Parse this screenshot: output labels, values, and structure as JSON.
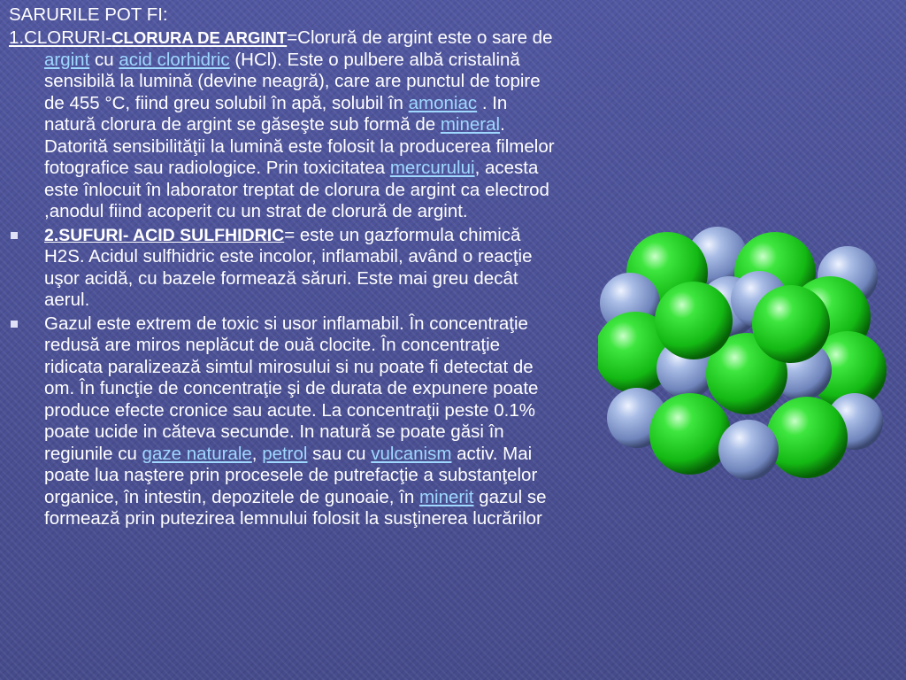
{
  "slide": {
    "title": "SARURILE POT FI:",
    "p1": {
      "prefix": "1.CLORURI-",
      "bold": "CLORURA DE ARGINT",
      "t1": "=Clorură de argint este o sare de ",
      "link1": "argint",
      "t2": " cu ",
      "link2": "acid clorhidric",
      "t3": " (HCl). Este o pulbere albă cristalină sensibilă la lumină (devine neagră), care are punctul de topire de 455 °C, fiind greu solubil în apă, solubil în ",
      "link3": "amoniac",
      "t4": " . In natură clorura de argint se găseşte sub formă de ",
      "link4": "mineral",
      "t5": ". Datorită sensibilităţii la lumină este folosit la producerea filmelor fotografice sau radiologice. Prin toxicitatea ",
      "link5": "mercurului",
      "t6": ", acesta este înlocuit în laborator treptat de clorura de argint ca electrod ,anodul fiind acoperit cu un strat de clorură de argint."
    },
    "b1": {
      "title": "2.SUFURI- ACID SULFHIDRIC",
      "text": "= este un gazformula chimică H2S. Acidul sulfhidric  este incolor, inflamabil, având o reacţie uşor acidă, cu bazele formează săruri. Este mai greu decât aerul."
    },
    "b2": {
      "t1": "Gazul este extrem de toxic si usor inflamabil. În concentraţie redusă are miros neplăcut de ouă clocite. În concentraţie ridicata paralizează simtul mirosului si nu poate fi detectat de om. În funcţie de concentraţie şi de durata de expunere poate produce efecte cronice sau acute. La concentraţii peste 0.1% poate ucide in căteva secunde. In natură se poate găsi în regiunile cu ",
      "link1": "gaze naturale",
      "t2": ", ",
      "link2": "petrol",
      "t3": " sau cu ",
      "link3": "vulcanism",
      "t4": " activ. Mai poate lua naştere prin procesele de putrefacţie a substanţelor organice, în intestin, depozitele de gunoaie, în ",
      "link4": "minerit",
      "t5": " gazul se formează prin putezirea lemnului folosit la susţinerea lucrărilor"
    }
  },
  "colors": {
    "link": "#9fd8ff",
    "chlorine": "#22cc22",
    "silver": "#8fa6d6",
    "background": "#4a4f94"
  },
  "icons": {
    "bullet": "square-bullet-icon",
    "figure": "crystal-lattice-model"
  }
}
